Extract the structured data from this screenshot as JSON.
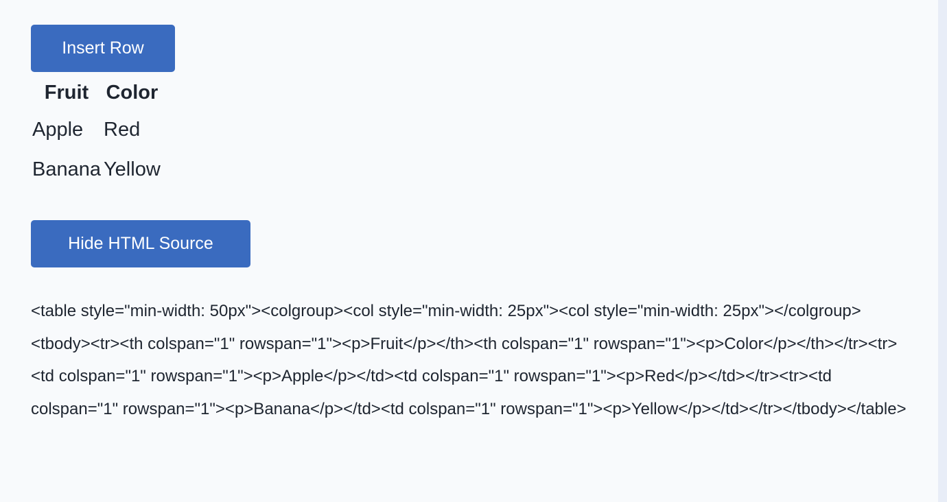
{
  "buttons": {
    "insert_row": "Insert Row",
    "hide_source": "Hide HTML Source"
  },
  "table": {
    "headers": [
      "Fruit",
      "Color"
    ],
    "rows": [
      [
        "Apple",
        "Red"
      ],
      [
        "Banana",
        "Yellow"
      ]
    ]
  },
  "html_source": "<table style=\"min-width: 50px\"><colgroup><col style=\"min-width: 25px\"><col style=\"min-width: 25px\"></colgroup><tbody><tr><th colspan=\"1\" rowspan=\"1\"><p>Fruit</p></th><th colspan=\"1\" rowspan=\"1\"><p>Color</p></th></tr><tr><td colspan=\"1\" rowspan=\"1\"><p>Apple</p></td><td colspan=\"1\" rowspan=\"1\"><p>Red</p></td></tr><tr><td colspan=\"1\" rowspan=\"1\"><p>Banana</p></td><td colspan=\"1\" rowspan=\"1\"><p>Yellow</p></td></tr></tbody></table>",
  "colors": {
    "button": "#3a6bbf",
    "background": "#f8fafc",
    "text": "#1e2530"
  }
}
